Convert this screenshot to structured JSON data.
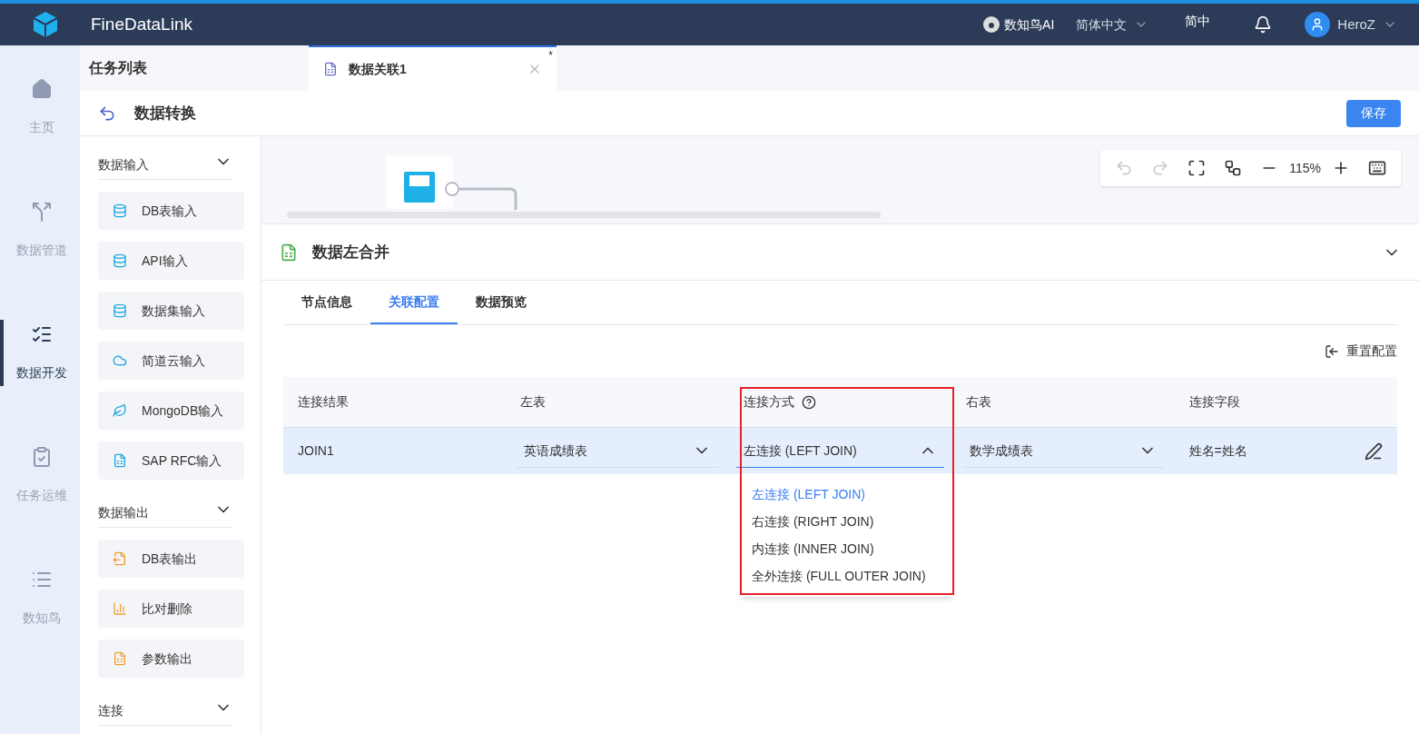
{
  "topbar": {
    "product": "FineDataLink",
    "ai": "数知鸟AI",
    "language": "简体中文",
    "short_lang": "简中",
    "user": "HeroZ"
  },
  "nav": [
    {
      "label": "主页",
      "kind": "home",
      "selected": false
    },
    {
      "label": "数据管道",
      "kind": "pipe",
      "selected": false
    },
    {
      "label": "数据开发",
      "kind": "dev",
      "selected": true
    },
    {
      "label": "任务运维",
      "kind": "ops",
      "selected": false
    },
    {
      "label": "数知鸟",
      "kind": "list",
      "selected": false
    }
  ],
  "task_list_title": "任务列表",
  "tabs": [
    {
      "label": "数据关联1",
      "modified": "*",
      "selected": true
    }
  ],
  "page": {
    "title": "数据转换",
    "save": "保存"
  },
  "palette": [
    {
      "title": "数据输入",
      "expanded": true,
      "items": [
        {
          "label": "DB表输入",
          "kind": "db"
        },
        {
          "label": "API输入",
          "kind": "api"
        },
        {
          "label": "数据集输入",
          "kind": "dataset"
        },
        {
          "label": "简道云输入",
          "kind": "cloud"
        },
        {
          "label": "MongoDB输入",
          "kind": "mongo"
        },
        {
          "label": "SAP RFC输入",
          "kind": "sap"
        }
      ]
    },
    {
      "title": "数据输出",
      "expanded": true,
      "items": [
        {
          "label": "DB表输出",
          "kind": "dbout"
        },
        {
          "label": "比对删除",
          "kind": "compare"
        },
        {
          "label": "参数输出",
          "kind": "param"
        }
      ]
    },
    {
      "title": "连接",
      "expanded": true
    }
  ],
  "canvas": {
    "zoom": "115%"
  },
  "node_panel": {
    "title": "数据左合并",
    "tabs": [
      {
        "label": "节点信息",
        "selected": false
      },
      {
        "label": "关联配置",
        "selected": true
      },
      {
        "label": "数据预览",
        "selected": false
      }
    ],
    "reset": "重置配置",
    "columns": [
      "连接结果",
      "左表",
      "连接方式",
      "右表",
      "连接字段"
    ],
    "row": {
      "result": "JOIN1",
      "left": "英语成绩表",
      "join": "左连接 (LEFT JOIN)",
      "right": "数学成绩表",
      "fields": "姓名=姓名"
    },
    "join_options": [
      {
        "label": "左连接 (LEFT JOIN)",
        "selected": true
      },
      {
        "label": "右连接 (RIGHT JOIN)",
        "selected": false
      },
      {
        "label": "内连接 (INNER JOIN)",
        "selected": false
      },
      {
        "label": "全外连接 (FULL OUTER JOIN)",
        "selected": false
      }
    ],
    "dropdown_open": true
  }
}
